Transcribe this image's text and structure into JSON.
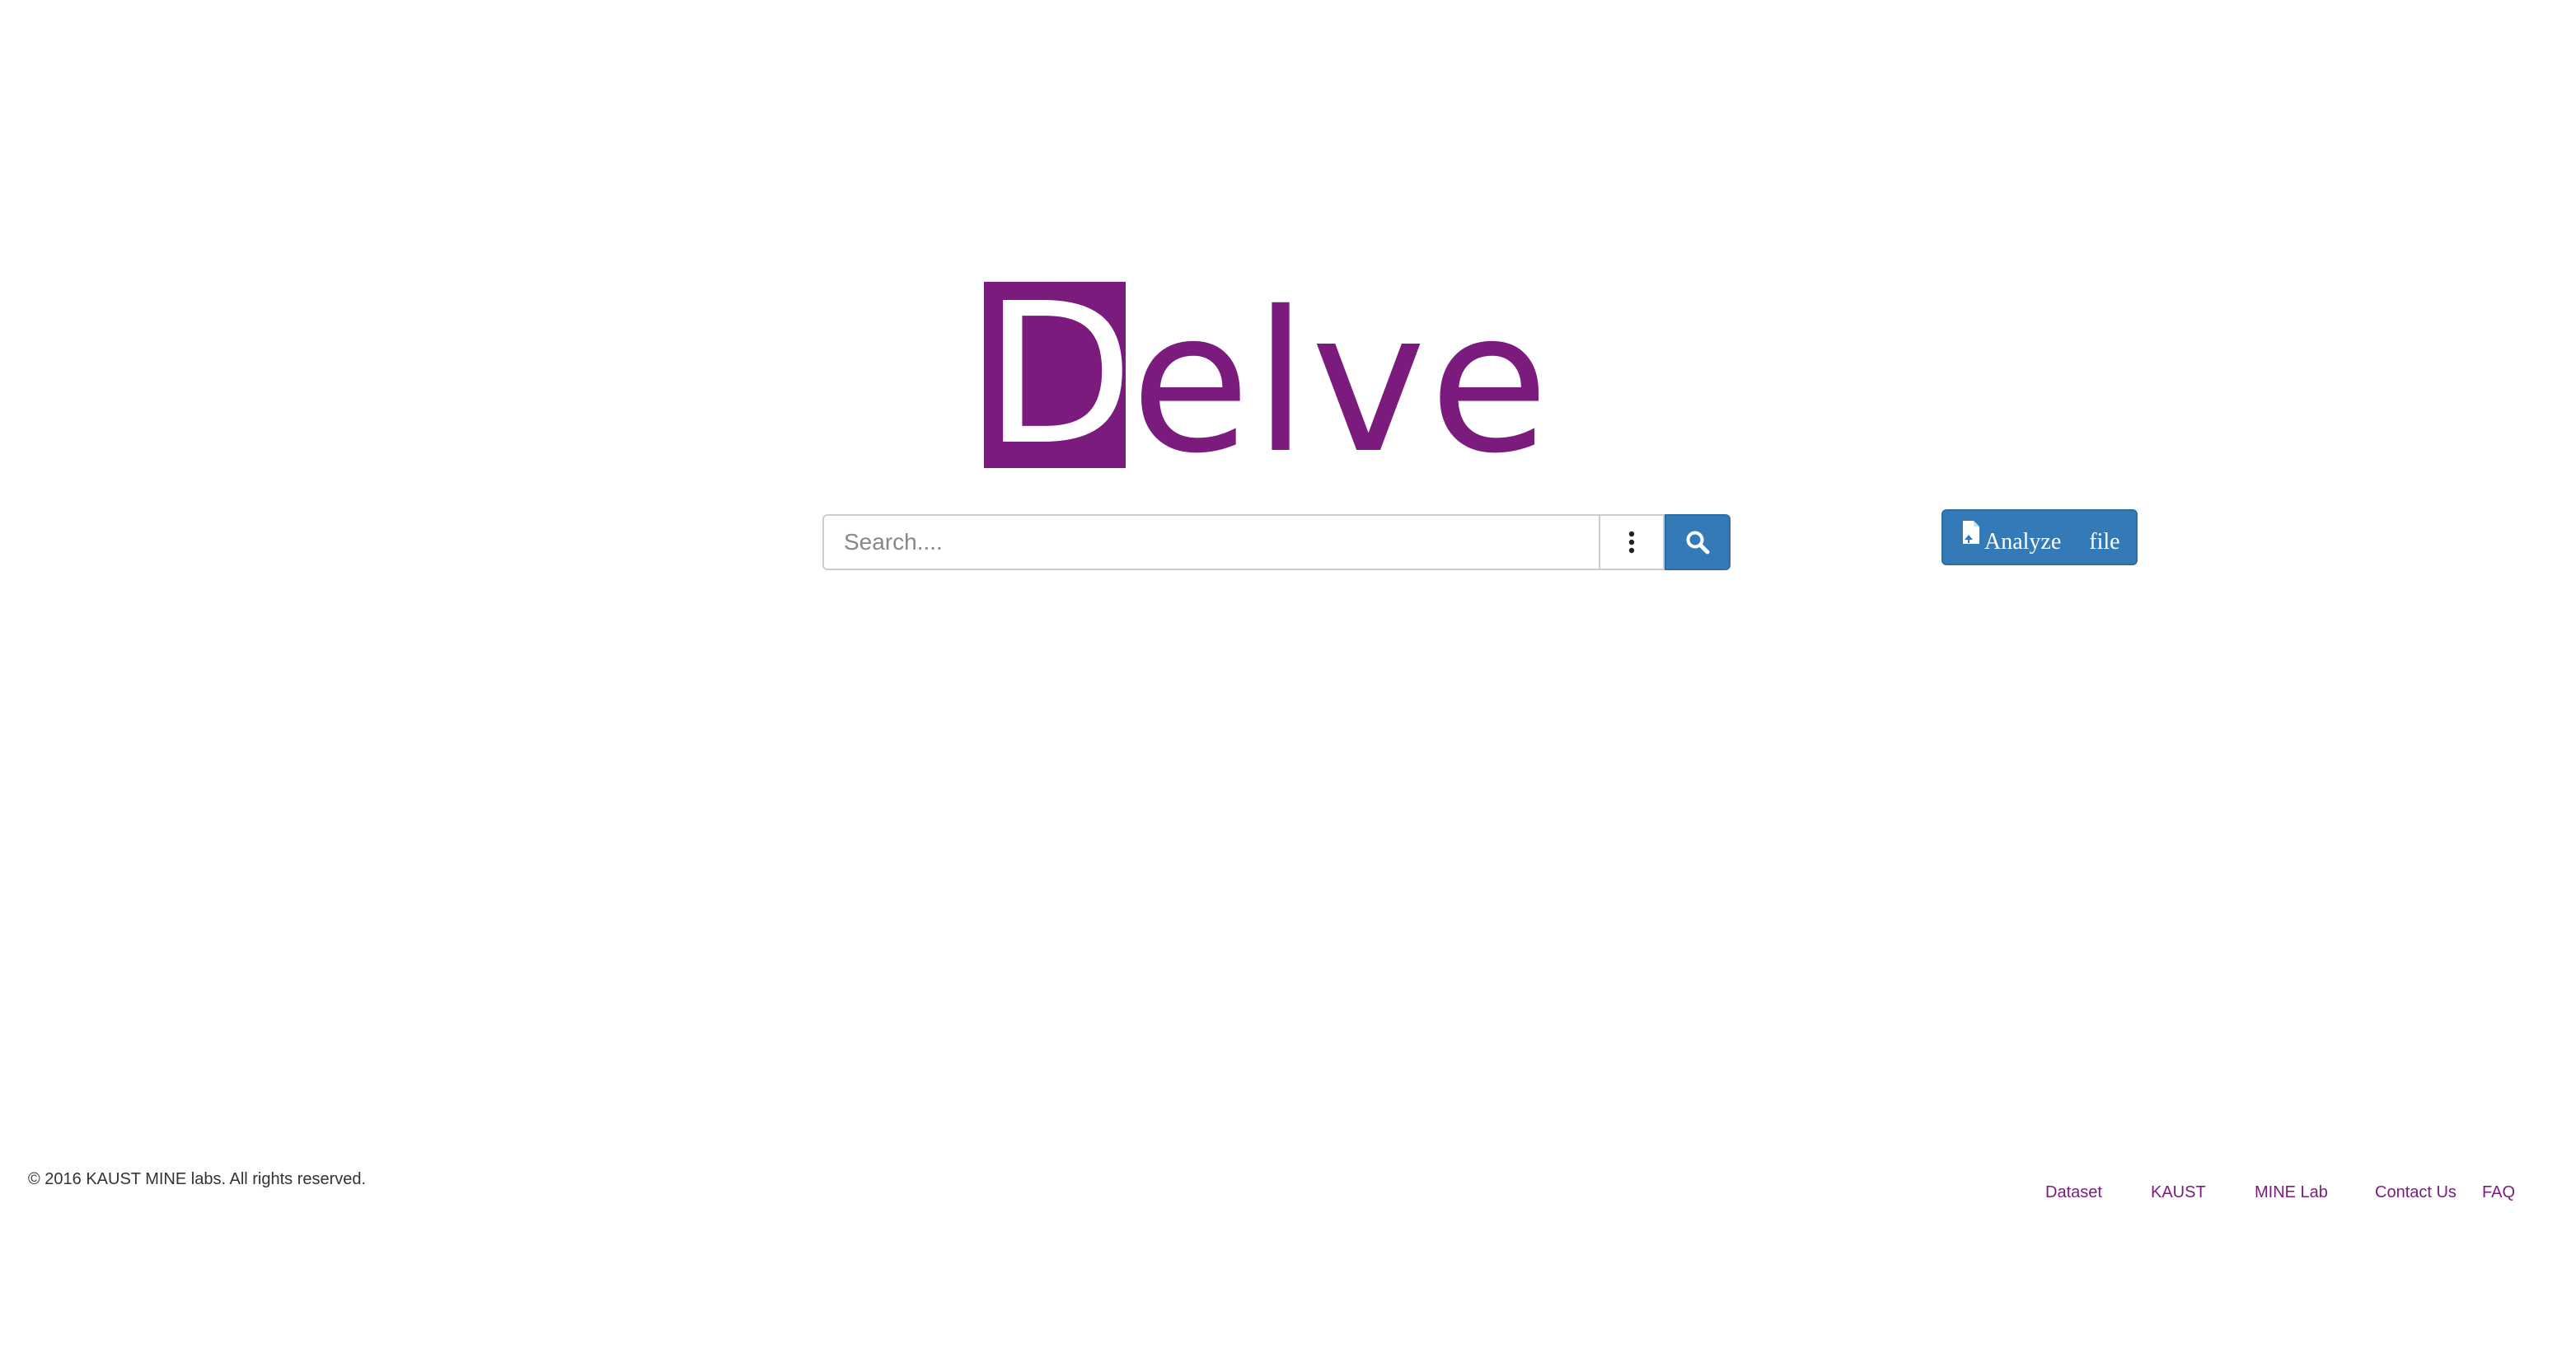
{
  "logo": {
    "first_letter": "D",
    "rest": "elve",
    "color": "#7b1b7e"
  },
  "search": {
    "placeholder": "Search....",
    "value": "",
    "options_icon": "vertical-ellipsis-icon",
    "submit_icon": "search-icon",
    "button_color": "#337ab7"
  },
  "analyze": {
    "icon": "file-upload-icon",
    "word1": "Analyze",
    "word2": "file"
  },
  "footer": {
    "copyright": "© 2016 KAUST MINE labs. All rights reserved.",
    "links": [
      "Dataset",
      "KAUST",
      "MINE Lab",
      "Contact Us",
      "FAQ"
    ]
  }
}
